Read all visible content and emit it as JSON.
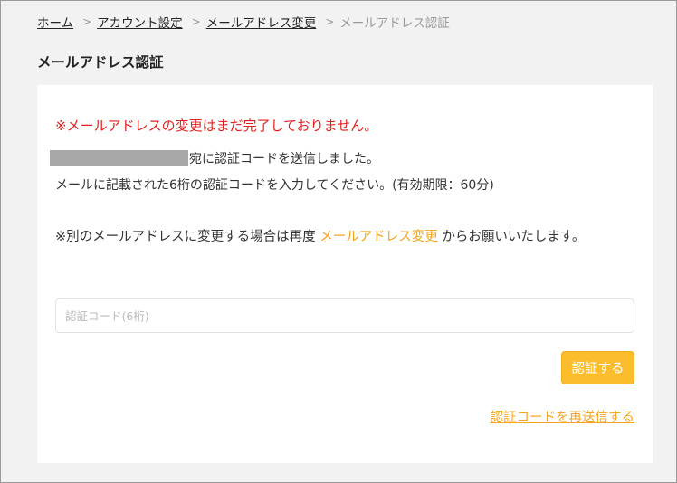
{
  "breadcrumb": {
    "items": [
      {
        "label": "ホーム"
      },
      {
        "label": "アカウント設定"
      },
      {
        "label": "メールアドレス変更"
      }
    ],
    "separator": ">",
    "current": "メールアドレス認証"
  },
  "page_title": "メールアドレス認証",
  "card": {
    "warning": "※メールアドレスの変更はまだ完了しておりません。",
    "sent_suffix": "宛に認証コードを送信しました。",
    "instruction": "メールに記載された6桁の認証コードを入力してください。(有効期限：60分)",
    "note_prefix": "※別のメールアドレスに変更する場合は再度",
    "note_link": "メールアドレス変更",
    "note_suffix": "からお願いいたします。",
    "code_placeholder": "認証コード(6桁)",
    "code_value": "",
    "submit_label": "認証する",
    "resend_label": "認証コードを再送信する"
  },
  "colors": {
    "warning": "#e02020",
    "accent": "#fbbd2c",
    "link": "#f4a521"
  }
}
